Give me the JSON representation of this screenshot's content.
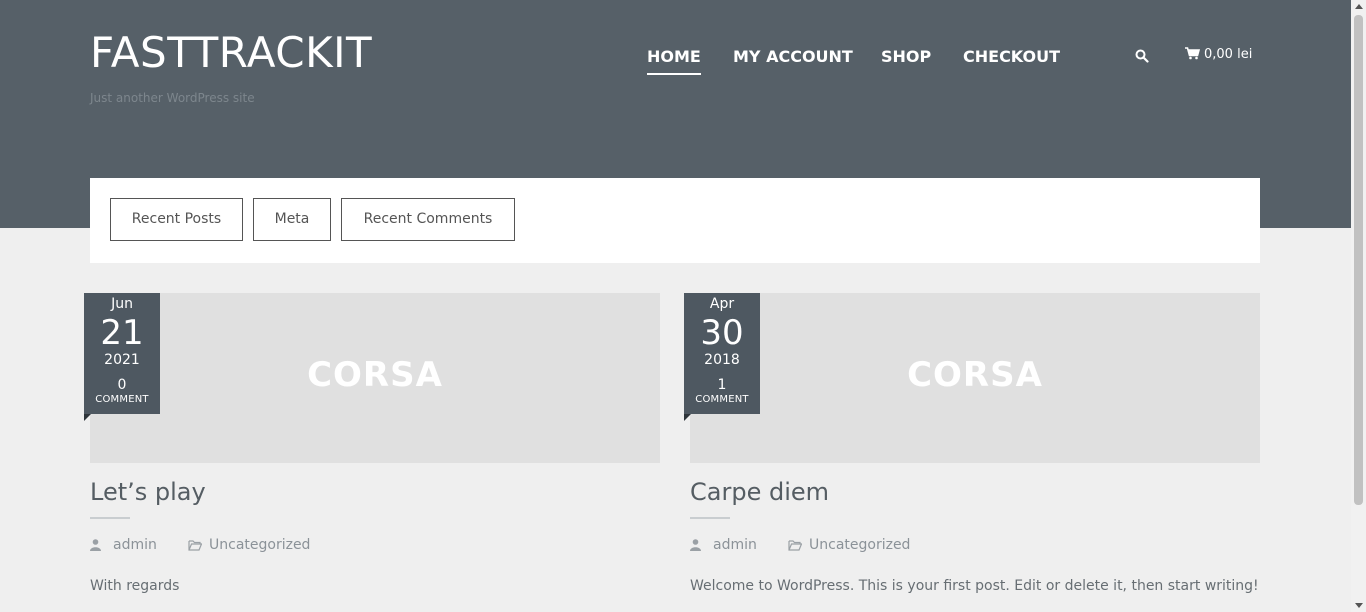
{
  "header": {
    "site_title": "FASTTRACKIT",
    "tagline": "Just another WordPress site",
    "nav": [
      {
        "label": "HOME",
        "active": true
      },
      {
        "label": "MY ACCOUNT",
        "active": false
      },
      {
        "label": "SHOP",
        "active": false
      },
      {
        "label": "CHECKOUT",
        "active": false
      }
    ],
    "search_icon": "search-icon",
    "cart_icon": "cart-icon",
    "cart_total": "0,00 lei"
  },
  "widgets": {
    "tabs": [
      "Recent Posts",
      "Meta",
      "Recent Comments"
    ]
  },
  "posts": [
    {
      "month": "Jun",
      "day": "21",
      "year": "2021",
      "comment_count": "0",
      "comment_label": "COMMENT",
      "image_text": "CORSA",
      "title": "Let’s play",
      "author": "admin",
      "category": "Uncategorized",
      "excerpt": "With regards"
    },
    {
      "month": "Apr",
      "day": "30",
      "year": "2018",
      "comment_count": "1",
      "comment_label": "COMMENT",
      "image_text": "CORSA",
      "title": "Carpe diem",
      "author": "admin",
      "category": "Uncategorized",
      "excerpt": "Welcome to WordPress. This is your first post. Edit or delete it, then start writing!"
    }
  ],
  "colors": {
    "header_bg": "#566068",
    "badge_bg": "#4e5861",
    "page_bg": "#efefef"
  }
}
